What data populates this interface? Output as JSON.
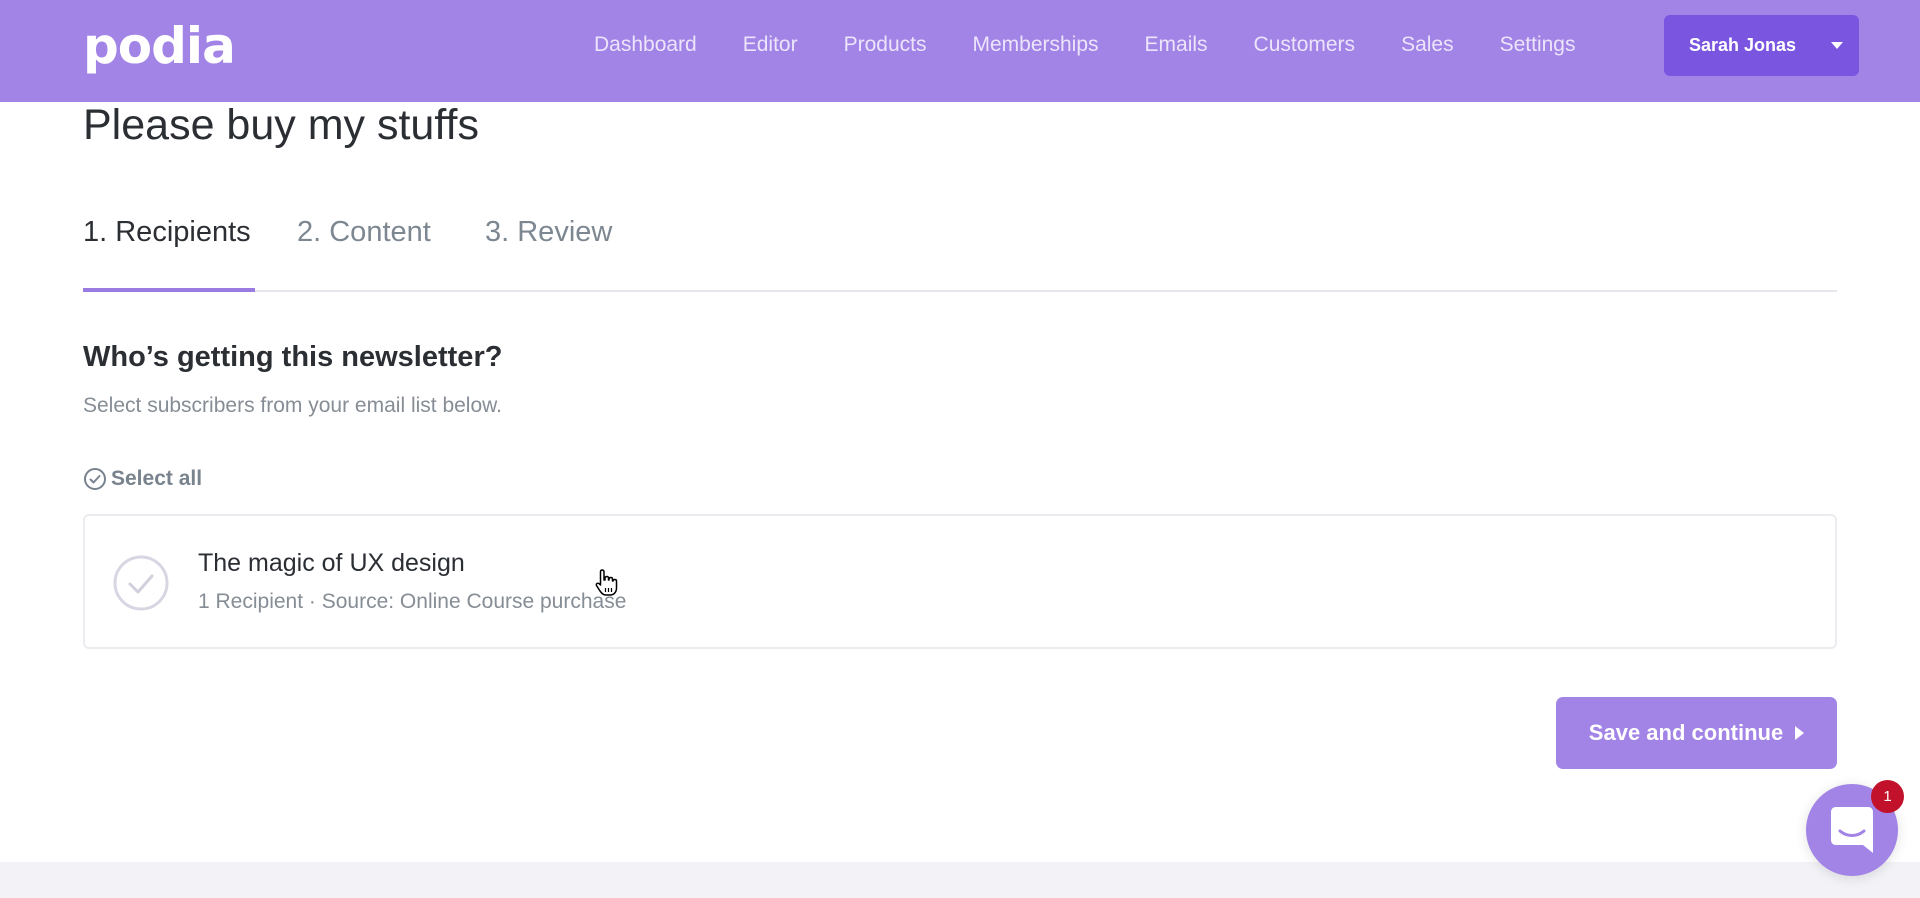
{
  "header": {
    "logo": "podia",
    "nav": [
      "Dashboard",
      "Editor",
      "Products",
      "Memberships",
      "Emails",
      "Customers",
      "Sales",
      "Settings"
    ],
    "user_name": "Sarah Jonas"
  },
  "page": {
    "title": "Please buy my stuffs"
  },
  "steps": [
    {
      "label": "1. Recipients",
      "active": true
    },
    {
      "label": "2. Content",
      "active": false
    },
    {
      "label": "3. Review",
      "active": false
    }
  ],
  "recipients": {
    "heading": "Who’s getting this newsletter?",
    "subheading": "Select subscribers from your email list below.",
    "select_all_label": "Select all",
    "lists": [
      {
        "name": "The magic of UX design",
        "meta": "1 Recipient · Source: Online Course purchase",
        "selected": false
      }
    ]
  },
  "actions": {
    "save_label": "Save and continue"
  },
  "chat": {
    "unread_count": "1"
  },
  "colors": {
    "brand": "#a283e6",
    "brand_dark": "#7a55e0",
    "badge": "#c2112a"
  }
}
